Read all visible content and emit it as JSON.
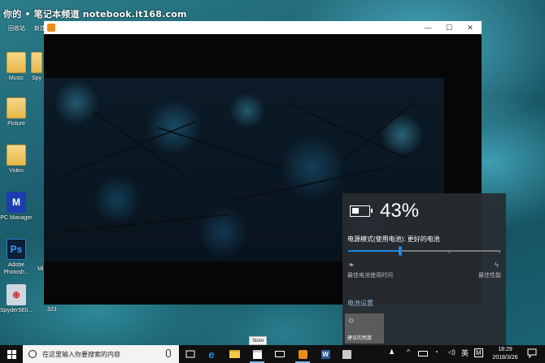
{
  "watermark": "你的 • 笔记本频道 notebook.it168.com",
  "desktop": {
    "top_labels": [
      "回收站",
      "新建"
    ],
    "icons": [
      {
        "label": "Music",
        "glyph": ""
      },
      {
        "label": "Spy",
        "glyph": ""
      },
      {
        "label": "Picture",
        "glyph": ""
      },
      {
        "label": "Video",
        "glyph": ""
      },
      {
        "label": "PC Manager",
        "glyph": "M"
      },
      {
        "label": "Adobe Photosh...",
        "glyph": "Ps"
      },
      {
        "label": "Mi",
        "glyph": ""
      },
      {
        "label": "Spyder5Eli...",
        "glyph": ""
      },
      {
        "label": "323",
        "glyph": ""
      }
    ]
  },
  "player": {
    "minimize": "—",
    "maximize": "☐",
    "close": "✕"
  },
  "battery_flyout": {
    "percent": "43%",
    "percent_value": 0.43,
    "power_mode_label": "电源模式(使用电池): 更好的电池",
    "slider_value": 0.34,
    "left_caption": "最佳电池使用时间",
    "right_caption": "最佳性能",
    "settings_link": "电池设置",
    "brightness_tile": "建议的亮度",
    "accent_color": "#1e86e4"
  },
  "tooltip": "Store",
  "taskbar": {
    "search_placeholder": "在这里输入你要搜索的内容",
    "ime": "英",
    "ime_mode": "M",
    "time": "18:29",
    "date": "2018/3/26"
  }
}
